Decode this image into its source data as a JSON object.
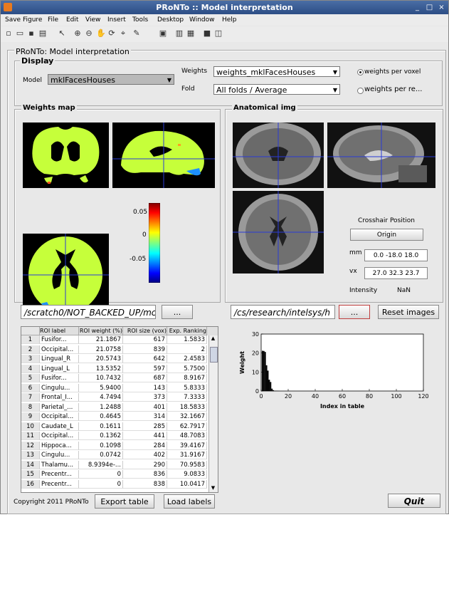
{
  "window": {
    "title": "PRoNTo :: Model interpretation"
  },
  "menubar": [
    "Save Figure",
    "File",
    "Edit",
    "View",
    "Insert",
    "Tools",
    "Desktop",
    "Window",
    "Help"
  ],
  "panel": {
    "title": "PRoNTo: Model interpretation"
  },
  "display": {
    "title": "Display",
    "model_label": "Model",
    "model_value": "mklFacesHouses",
    "weights_label": "Weights",
    "weights_value": "weights_mklFacesHouses",
    "fold_label": "Fold",
    "fold_value": "All folds / Average",
    "radio_voxel": "weights per voxel",
    "radio_region": "weights per re..."
  },
  "weights_map": {
    "title": "Weights map",
    "colorbar_ticks": [
      "0.05",
      "0",
      "-0.05"
    ],
    "path": "/scratch0/NOT_BACKED_UP/mc",
    "browse_label": "..."
  },
  "anatomical": {
    "title": "Anatomical img",
    "crosshair_title": "Crosshair Position",
    "origin_label": "Origin",
    "mm_label": "mm",
    "mm_value": "0.0 -18.0 18.0",
    "vx_label": "vx",
    "vx_value": "27.0 32.3 23.7",
    "intensity_label": "Intensity",
    "intensity_value": "NaN",
    "path": "/cs/research/intelsys/h",
    "browse_label": "...",
    "reset_label": "Reset images"
  },
  "table": {
    "headers": [
      "",
      "ROI label",
      "ROI weight (%)",
      "ROI size (vox)",
      "Exp. Ranking"
    ],
    "rows": [
      [
        "1",
        "Fusifor...",
        "21.1867",
        "617",
        "1.5833"
      ],
      [
        "2",
        "Occipital...",
        "21.0758",
        "839",
        "2"
      ],
      [
        "3",
        "Lingual_R",
        "20.5743",
        "642",
        "2.4583"
      ],
      [
        "4",
        "Lingual_L",
        "13.5352",
        "597",
        "5.7500"
      ],
      [
        "5",
        "Fusifor...",
        "10.7432",
        "687",
        "8.9167"
      ],
      [
        "6",
        "Cingulu...",
        "5.9400",
        "143",
        "5.8333"
      ],
      [
        "7",
        "Frontal_I...",
        "4.7494",
        "373",
        "7.3333"
      ],
      [
        "8",
        "Parietal_...",
        "1.2488",
        "401",
        "18.5833"
      ],
      [
        "9",
        "Occipital...",
        "0.4645",
        "314",
        "32.1667"
      ],
      [
        "10",
        "Caudate_L",
        "0.1611",
        "285",
        "62.7917"
      ],
      [
        "11",
        "Occipital...",
        "0.1362",
        "441",
        "48.7083"
      ],
      [
        "12",
        "Hippoca...",
        "0.1098",
        "284",
        "39.4167"
      ],
      [
        "13",
        "Cingulu...",
        "0.0742",
        "402",
        "31.9167"
      ],
      [
        "14",
        "Thalamu...",
        "8.9394e-...",
        "290",
        "70.9583"
      ],
      [
        "15",
        "Precentr...",
        "0",
        "836",
        "9.0833"
      ],
      [
        "16",
        "Precentr...",
        "0",
        "838",
        "10.0417"
      ]
    ]
  },
  "chart_data": {
    "type": "bar",
    "xlabel": "Index in table",
    "ylabel": "Weight",
    "xlim": [
      0,
      120
    ],
    "ylim": [
      0,
      30
    ],
    "xticks": [
      "0",
      "20",
      "40",
      "60",
      "80",
      "100",
      "120"
    ],
    "yticks": [
      "0",
      "10",
      "20",
      "30"
    ],
    "x": [
      1,
      2,
      3,
      4,
      5,
      6,
      7,
      8,
      9,
      10,
      11,
      12,
      13,
      14,
      15,
      16
    ],
    "values": [
      21.19,
      21.08,
      20.57,
      13.54,
      10.74,
      5.94,
      4.75,
      1.25,
      0.46,
      0.16,
      0.14,
      0.11,
      0.07,
      0.0,
      0,
      0
    ]
  },
  "footer": {
    "copyright": "Copyright 2011 PRoNTo",
    "export_label": "Export table",
    "load_label": "Load labels",
    "quit_label": "Quit"
  }
}
